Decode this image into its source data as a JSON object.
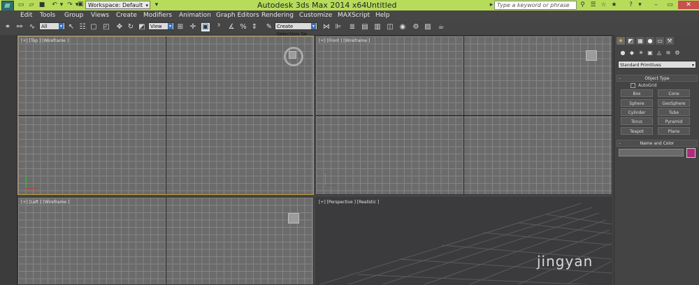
{
  "titlebar": {
    "workspace": "Workspace: Default",
    "app_title": "Autodesk 3ds Max  2014 x64",
    "doc_title": "Untitled",
    "search_placeholder": "Type a keyword or phrase"
  },
  "menu": [
    "Edit",
    "Tools",
    "Group",
    "Views",
    "Create",
    "Modifiers",
    "Animation",
    "Graph Editors",
    "Rendering",
    "Customize",
    "MAXScript",
    "Help"
  ],
  "toolbar": {
    "selection_filter": "All",
    "ref_coord": "View",
    "named_selection": "Create Selection Se"
  },
  "viewports": {
    "top": "[+] [Top ] [Wireframe ]",
    "front": "[+] [Front ] [Wireframe ]",
    "left": "[+] [Left ] [Wireframe ]",
    "perspective": "[+] [Perspective ] [Realistic ]"
  },
  "command_panel": {
    "category": "Standard Primitives",
    "object_type_title": "Object Type",
    "autogrid": "AutoGrid",
    "buttons": [
      "Box",
      "Cone",
      "Sphere",
      "GeoSphere",
      "Cylinder",
      "Tube",
      "Torus",
      "Pyramid",
      "Teapot",
      "Plane"
    ],
    "name_color_title": "Name and Color",
    "color": "#b02a79"
  },
  "watermark": "jingyan"
}
